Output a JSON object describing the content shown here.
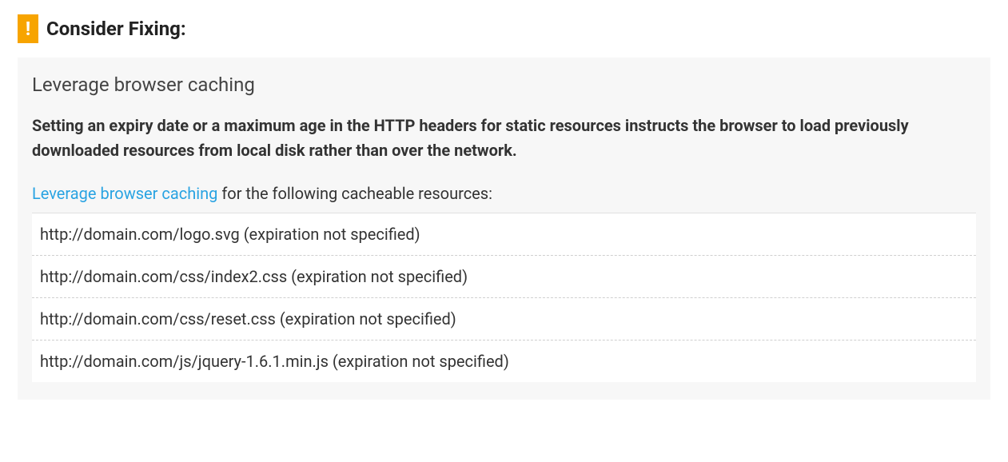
{
  "header": {
    "badge_char": "!",
    "title": "Consider Fixing:"
  },
  "panel": {
    "title": "Leverage browser caching",
    "description": "Setting an expiry date or a maximum age in the HTTP headers for static resources instructs the browser to load previously downloaded resources from local disk rather than over the network.",
    "link_text": "Leverage browser caching",
    "sub_text_suffix": " for the following cacheable resources:"
  },
  "resources": [
    "http://domain.com/logo.svg (expiration not specified)",
    "http://domain.com/css/index2.css (expiration not specified)",
    "http://domain.com/css/reset.css (expiration not specified)",
    "http://domain.com/js/jquery-1.6.1.min.js (expiration not specified)"
  ],
  "colors": {
    "warn_bg": "#f7a400",
    "link": "#29a3e2",
    "panel_bg": "#f7f7f7"
  }
}
